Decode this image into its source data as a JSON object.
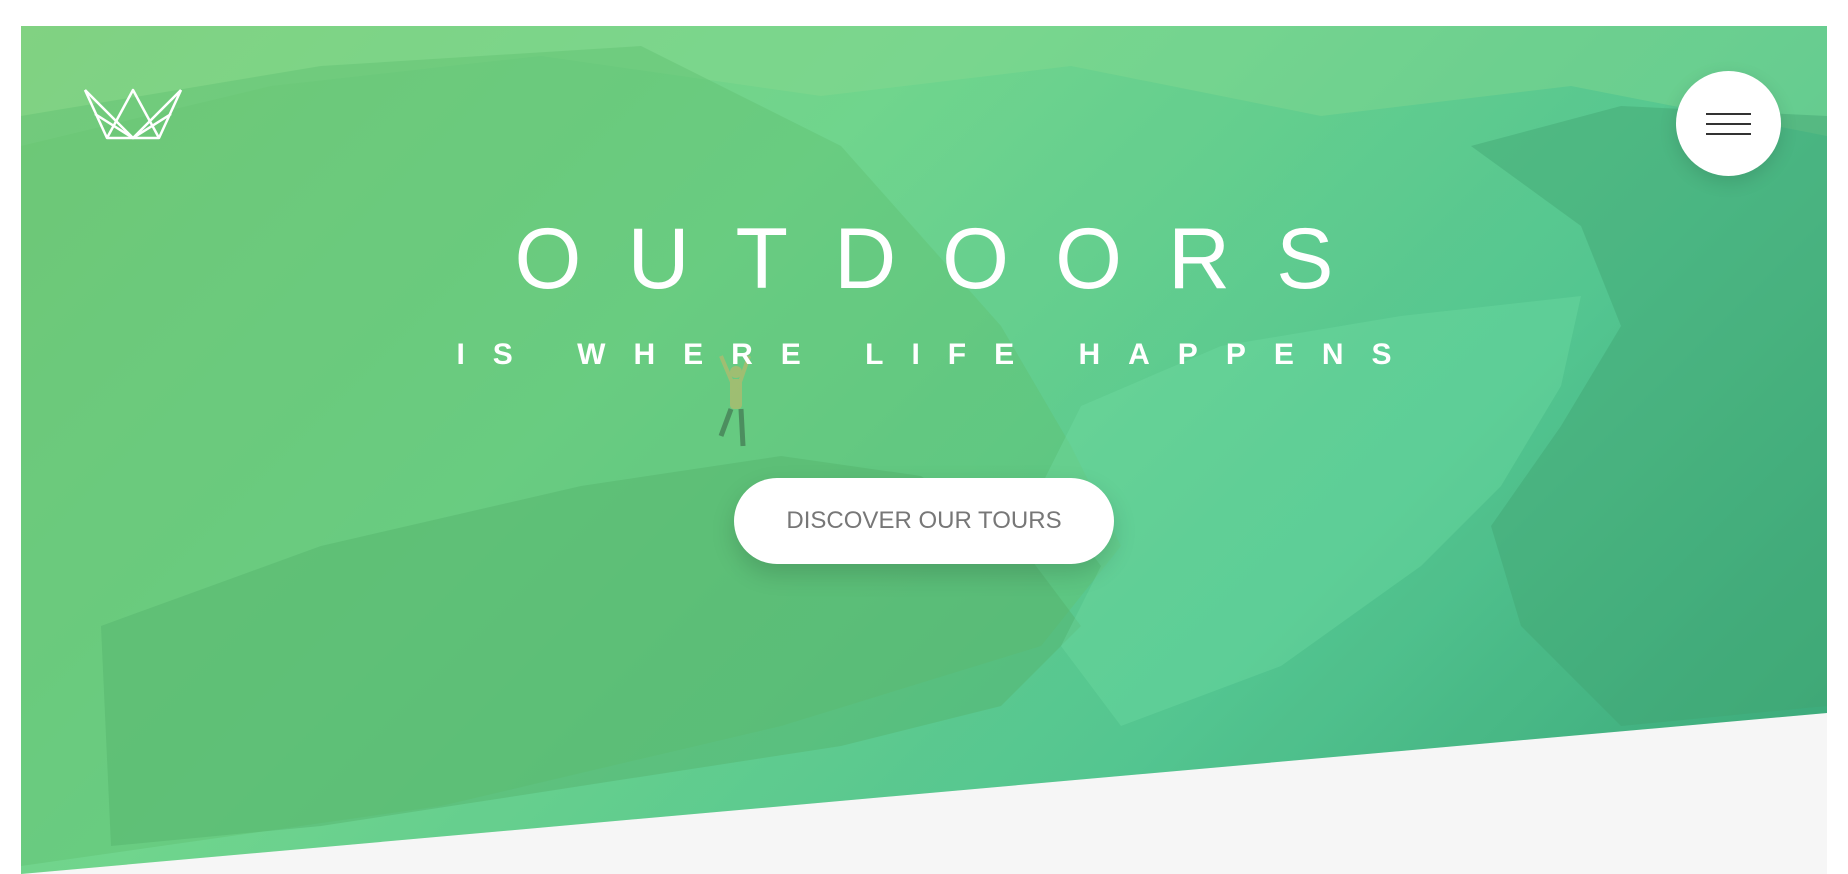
{
  "brand": {
    "logo_icon": "crown-icon"
  },
  "nav": {
    "menu_icon": "hamburger-menu-icon"
  },
  "hero": {
    "title": "OUTDOORS",
    "subtitle": "IS WHERE LIFE HAPPENS",
    "cta_label": "DISCOVER OUR TOURS"
  },
  "colors": {
    "gradient_start": "#7bcc78",
    "gradient_mid": "#6fd58e",
    "gradient_end": "#2f9f74",
    "section_background": "#f6f6f6",
    "text_light": "#ffffff",
    "button_text": "#777777"
  }
}
